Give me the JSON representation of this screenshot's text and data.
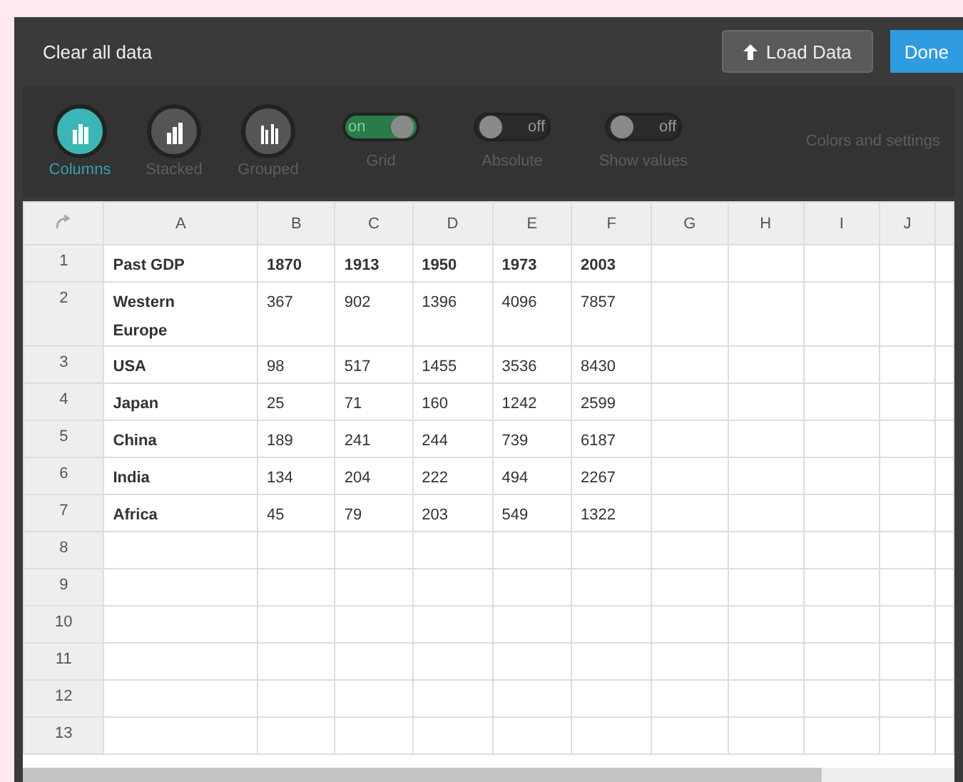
{
  "header": {
    "clear_label": "Clear all data",
    "load_button": "Load Data",
    "done_button": "Done"
  },
  "chart_types": [
    {
      "label": "Columns",
      "kind": "columns",
      "selected": true
    },
    {
      "label": "Stacked",
      "kind": "stacked",
      "selected": false
    },
    {
      "label": "Grouped",
      "kind": "grouped",
      "selected": false
    }
  ],
  "toggles": [
    {
      "label": "Grid",
      "state_text": "on",
      "on": true
    },
    {
      "label": "Absolute",
      "state_text": "off",
      "on": false
    },
    {
      "label": "Show values",
      "state_text": "off",
      "on": false
    }
  ],
  "settings_link": "Colors and settings",
  "table": {
    "columns": [
      "A",
      "B",
      "C",
      "D",
      "E",
      "F",
      "G",
      "H",
      "I",
      "J"
    ],
    "rows": [
      {
        "number": "1",
        "cells": [
          "Past GDP",
          "1870",
          "1913",
          "1950",
          "1973",
          "2003"
        ]
      },
      {
        "number": "2",
        "cells": [
          "Western Europe",
          "367",
          "902",
          "1396",
          "4096",
          "7857"
        ]
      },
      {
        "number": "3",
        "cells": [
          "USA",
          "98",
          "517",
          "1455",
          "3536",
          "8430"
        ]
      },
      {
        "number": "4",
        "cells": [
          "Japan",
          "25",
          "71",
          "160",
          "1242",
          "2599"
        ]
      },
      {
        "number": "5",
        "cells": [
          "China",
          "189",
          "241",
          "244",
          "739",
          "6187"
        ]
      },
      {
        "number": "6",
        "cells": [
          "India",
          "134",
          "204",
          "222",
          "494",
          "2267"
        ]
      },
      {
        "number": "7",
        "cells": [
          "Africa",
          "45",
          "79",
          "203",
          "549",
          "1322"
        ]
      },
      {
        "number": "8",
        "cells": []
      },
      {
        "number": "9",
        "cells": []
      },
      {
        "number": "10",
        "cells": []
      },
      {
        "number": "11",
        "cells": []
      },
      {
        "number": "12",
        "cells": []
      },
      {
        "number": "13",
        "cells": []
      }
    ]
  }
}
